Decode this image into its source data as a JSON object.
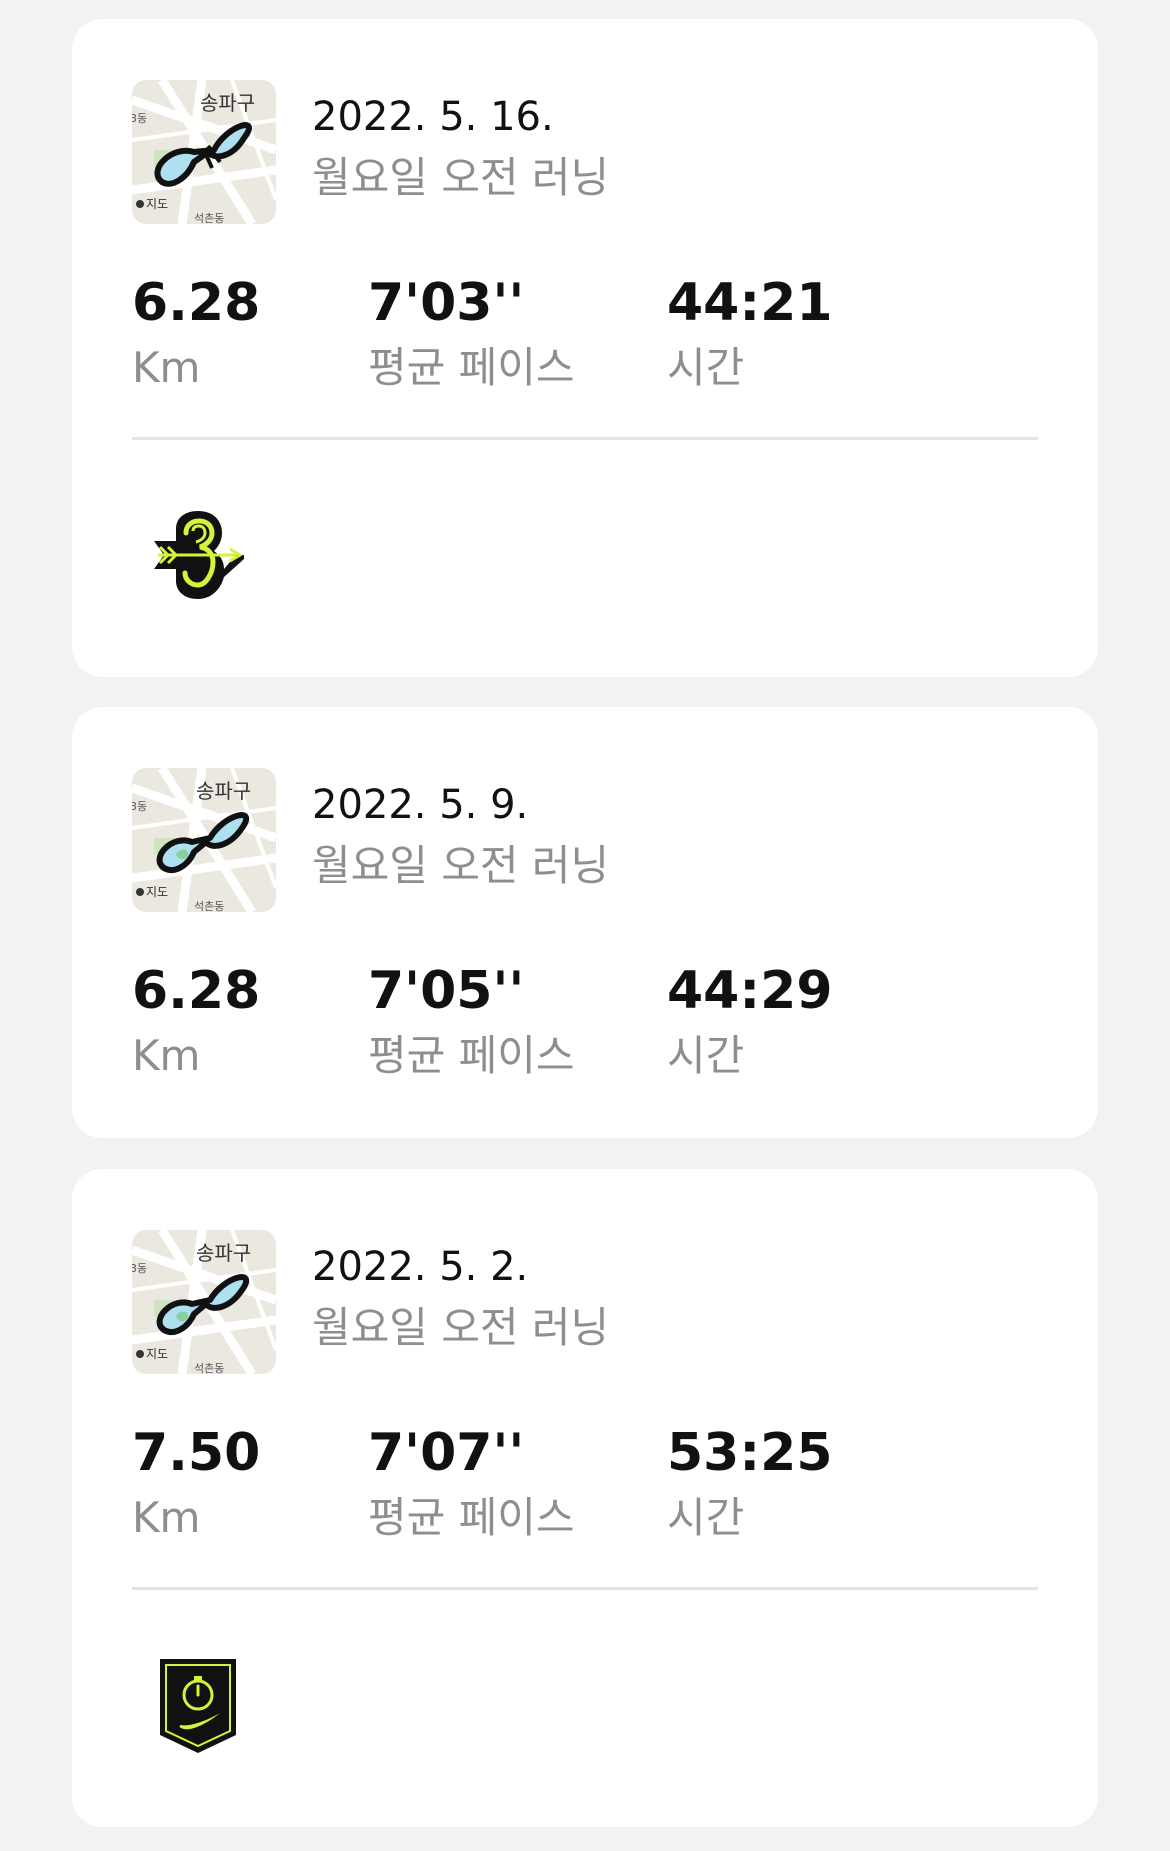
{
  "runs": [
    {
      "date": "2022. 5. 16.",
      "title": "월요일 오전 러닝",
      "map": {
        "district_label": "송파구",
        "left_label": "3동",
        "bottom_label": "석촌동",
        "maps_label": "지도"
      },
      "stats": [
        {
          "value": "6.28",
          "label": "Km"
        },
        {
          "value": "7'03''",
          "label": "평균 페이스"
        },
        {
          "value": "44:21",
          "label": "시간"
        }
      ],
      "badge": "streak-3-badge"
    },
    {
      "date": "2022. 5. 9.",
      "title": "월요일 오전 러닝",
      "map": {
        "district_label": "송파구",
        "left_label": "3동",
        "bottom_label": "석촌동",
        "maps_label": "지도"
      },
      "stats": [
        {
          "value": "6.28",
          "label": "Km"
        },
        {
          "value": "7'05''",
          "label": "평균 페이스"
        },
        {
          "value": "44:29",
          "label": "시간"
        }
      ]
    },
    {
      "date": "2022. 5. 2.",
      "title": "월요일 오전 러닝",
      "map": {
        "district_label": "송파구",
        "left_label": "3동",
        "bottom_label": "석촌동",
        "maps_label": "지도"
      },
      "stats": [
        {
          "value": "7.50",
          "label": "Km"
        },
        {
          "value": "7'07''",
          "label": "평균 페이스"
        },
        {
          "value": "53:25",
          "label": "시간"
        }
      ],
      "badge": "stopwatch-shield-badge"
    }
  ],
  "colors": {
    "background": "#f2f2f2",
    "card": "#ffffff",
    "primary_text": "#111111",
    "secondary_text": "#8e8e8e",
    "badge_accent": "#d8f13a",
    "route_fill": "#aee0f2"
  }
}
